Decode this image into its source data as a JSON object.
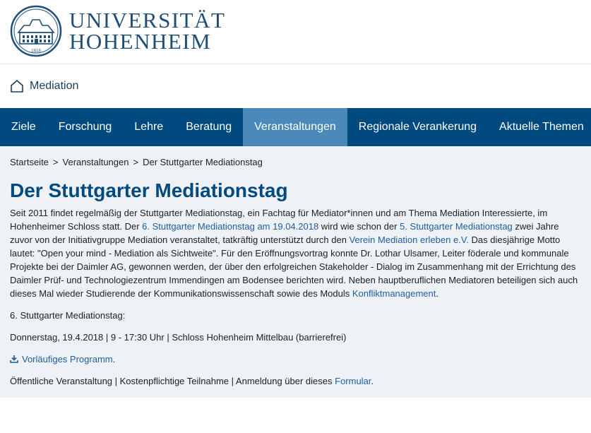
{
  "header": {
    "line1": "UNIVERSITÄT",
    "line2": "HOHENHEIM",
    "logo_year": "1818",
    "logo_icon": "castle-seal-icon"
  },
  "sub_header": {
    "title": "Mediation",
    "icon": "home-icon"
  },
  "nav": {
    "items": [
      {
        "label": "Ziele"
      },
      {
        "label": "Forschung"
      },
      {
        "label": "Lehre"
      },
      {
        "label": "Beratung"
      },
      {
        "label": "Veranstaltungen",
        "active": true
      },
      {
        "label": "Regionale Verankerung"
      },
      {
        "label": "Aktuelle Themen"
      }
    ]
  },
  "breadcrumb": {
    "home": "Startseite",
    "section": "Veranstaltungen",
    "current": "Der Stuttgarter Mediationstag",
    "separator": ">"
  },
  "page": {
    "title": "Der Stuttgarter Mediationstag",
    "intro": {
      "t1": "Seit 2011 findet regelmäßig der Stuttgarter Mediationstag, ein Fachtag für Mediator*innen und am Thema Mediation Interessierte, im Hohenheimer Schloss statt. Der ",
      "link1": "6. Stuttgarter Mediationstag am 19.04.2018",
      "t2": " wird wie schon der ",
      "link2": "5. Stuttgarter Mediationstag",
      "t3": " zwei Jahre zuvor von der Initiativgruppe Mediation veranstaltet, tatkräftig unterstützt durch den ",
      "link3": "Verein Mediation erleben e.V.",
      "t4": "  Das diesjährige Motto lautet: \"Open your mind - Mediation als Sichtweite\". Für den Eröffnungsvortrag konnte Dr. Lothar Ulsamer, Leiter föderale und kommunale Projekte bei der Daimler AG, gewonnen werden, der über den erfolgreichen Stakeholder - Dialog im Zusammenhang mit der Errichtung des Daimler Prüf- und Technologiezentrum Immendingen am Bodensee berichten wird. Neben hauptberuflichen Mediatoren beteiligen sich auch dieses Mal wieder Studierende der Kommunikationswissenschaft sowie des Moduls ",
      "link4": "Konfliktmanagement",
      "t5": "."
    },
    "event_heading": "6. Stuttgarter Mediationstag:",
    "event_details": "Donnerstag, 19.4.2018 | 9 - 17:30 Uhr | Schloss Hohenheim Mittelbau (barrierefrei)",
    "program_link": "Vorläufiges Programm",
    "program_suffix": ".",
    "footer_text": "Öffentliche Veranstaltung | Kostenpflichtige Teilnahme | Anmeldung über dieses ",
    "footer_link": "Formular",
    "footer_suffix": "."
  },
  "colors": {
    "brand": "#004a7f",
    "nav_active": "#4a89b9",
    "link": "#1f5fa3",
    "content_bg": "#eef1f5"
  }
}
